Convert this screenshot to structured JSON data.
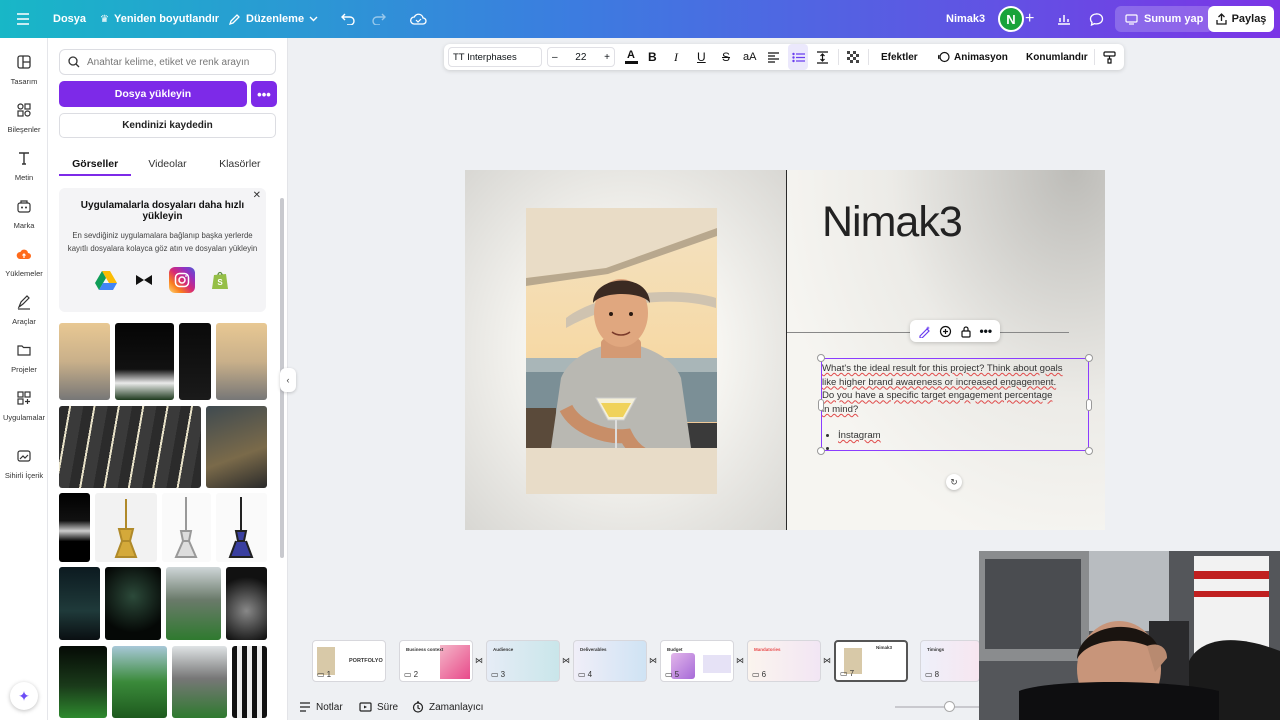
{
  "topbar": {
    "file": "Dosya",
    "resize": "Yeniden boyutlandır",
    "edit": "Düzenleme",
    "project_name": "Nimak3",
    "avatar_initial": "N",
    "present": "Sunum yap",
    "share": "Paylaş"
  },
  "rail": {
    "items": [
      {
        "label": "Tasarım"
      },
      {
        "label": "Bileşenler"
      },
      {
        "label": "Metin"
      },
      {
        "label": "Marka"
      },
      {
        "label": "Yüklemeler"
      },
      {
        "label": "Araçlar"
      },
      {
        "label": "Projeler"
      },
      {
        "label": "Uygulamalar"
      },
      {
        "label": "Sihirli İçerik"
      }
    ]
  },
  "panel": {
    "search_placeholder": "Anahtar kelime, etiket ve renk arayın",
    "upload_button": "Dosya yükleyin",
    "more": "•••",
    "record_button": "Kendinizi kaydedin",
    "tabs": [
      "Görseller",
      "Videolar",
      "Klasörler"
    ],
    "promo": {
      "title": "Uygulamalarla dosyaları daha hızlı yükleyin",
      "body": "En sevdiğiniz uygulamalara bağlanıp başka yerlerde kayıtlı dosyalara kolayca göz atın ve dosyaları yükleyin"
    }
  },
  "text_toolbar": {
    "font": "TT Interphases",
    "minus": "–",
    "size": "22",
    "plus": "+",
    "bold": "B",
    "italic": "I",
    "underline": "U",
    "strike": "S",
    "case": "aA",
    "effects": "Efektler",
    "animation": "Animasyon",
    "position": "Konumlandır"
  },
  "canvas": {
    "title": "Nimak3",
    "paragraph_lines": [
      "What's the ideal result for this project? Think about goals",
      "like higher brand awareness or increased engagement.",
      "Do you have a specific target engagement percentage",
      "in mind?"
    ],
    "bullets": [
      "İnstagram",
      ""
    ]
  },
  "filmstrip": {
    "slides": [
      {
        "num": "1",
        "caption": "PORTFOLYO"
      },
      {
        "num": "2",
        "caption": "Business context"
      },
      {
        "num": "3",
        "caption": "Audience"
      },
      {
        "num": "4",
        "caption": "Deliverables"
      },
      {
        "num": "5",
        "caption": "Budget"
      },
      {
        "num": "6",
        "caption": "Mandatories"
      },
      {
        "num": "7",
        "caption": "Nimak3"
      },
      {
        "num": "8",
        "caption": "Timings"
      }
    ]
  },
  "bottombar": {
    "notes": "Notlar",
    "duration": "Süre",
    "timer": "Zamanlayıcı"
  },
  "colors": {
    "accent": "#7d2ae8",
    "selection": "#8b3dff",
    "topbar_start": "#18b7c7",
    "topbar_end": "#7b35e6"
  }
}
